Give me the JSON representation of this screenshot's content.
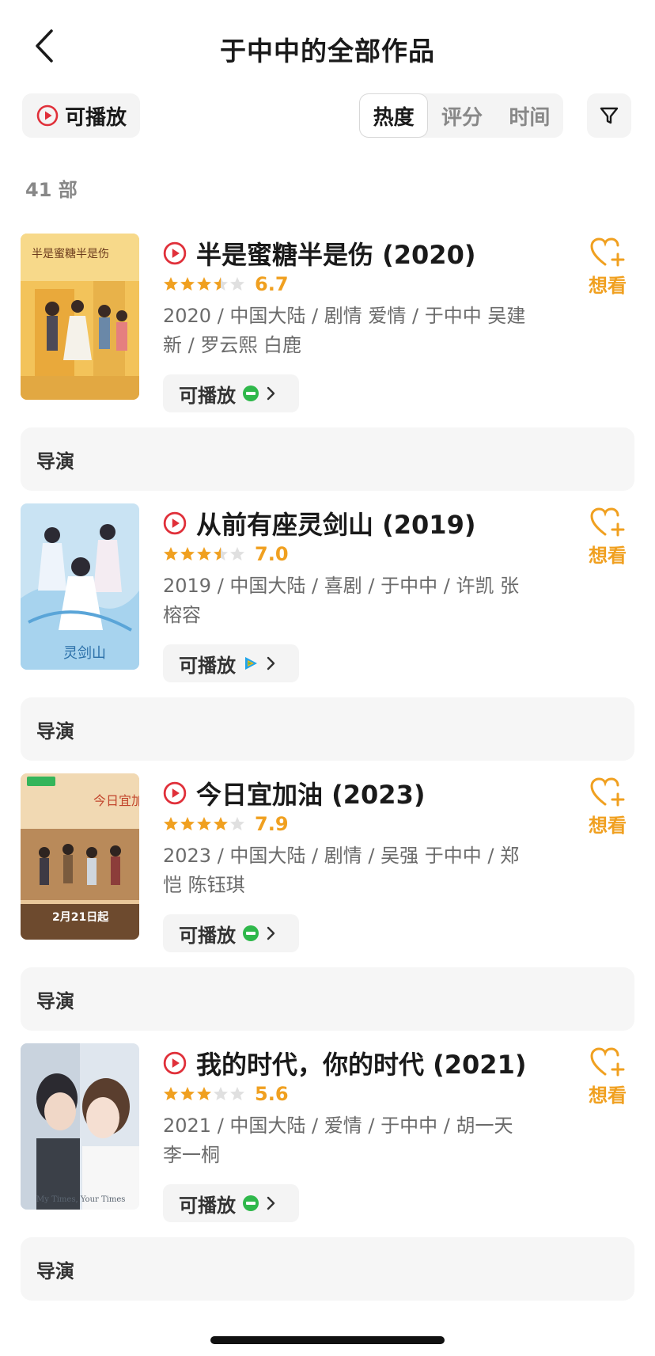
{
  "header": {
    "title": "于中中的全部作品"
  },
  "filters": {
    "playable_label": "可播放",
    "sort_tabs": [
      "热度",
      "评分",
      "时间"
    ],
    "active_sort": "热度"
  },
  "count_label": "41 部",
  "movies": [
    {
      "title": "半是蜜糖半是伤 (2020)",
      "rating": "6.7",
      "stars": 3.5,
      "meta": "2020 / 中国大陆 / 剧情 爱情 / 于中中 吴建新 / 罗云熙 白鹿",
      "play_label": "可播放",
      "platform": "iqiyi",
      "want_label": "想看",
      "director_label": "导演"
    },
    {
      "title": "从前有座灵剑山 (2019)",
      "rating": "7.0",
      "stars": 3.5,
      "meta": "2019 / 中国大陆 / 喜剧 / 于中中 / 许凯 张榕容",
      "play_label": "可播放",
      "platform": "tencent",
      "want_label": "想看",
      "director_label": "导演"
    },
    {
      "title": "今日宜加油 (2023)",
      "rating": "7.9",
      "stars": 4,
      "meta": "2023 / 中国大陆 / 剧情 / 吴强 于中中 / 郑恺 陈钰琪",
      "play_label": "可播放",
      "platform": "iqiyi",
      "want_label": "想看",
      "director_label": "导演"
    },
    {
      "title": "我的时代，你的时代 (2021)",
      "rating": "5.6",
      "stars": 3,
      "meta": "2021 / 中国大陆 / 爱情 / 于中中 / 胡一天 李一桐",
      "play_label": "可播放",
      "platform": "iqiyi",
      "want_label": "想看",
      "director_label": "导演"
    }
  ],
  "colors": {
    "accent": "#f0a020",
    "play_red": "#e0303a",
    "chip_bg": "#f4f4f4",
    "iqiyi_green": "#2fb84b"
  }
}
